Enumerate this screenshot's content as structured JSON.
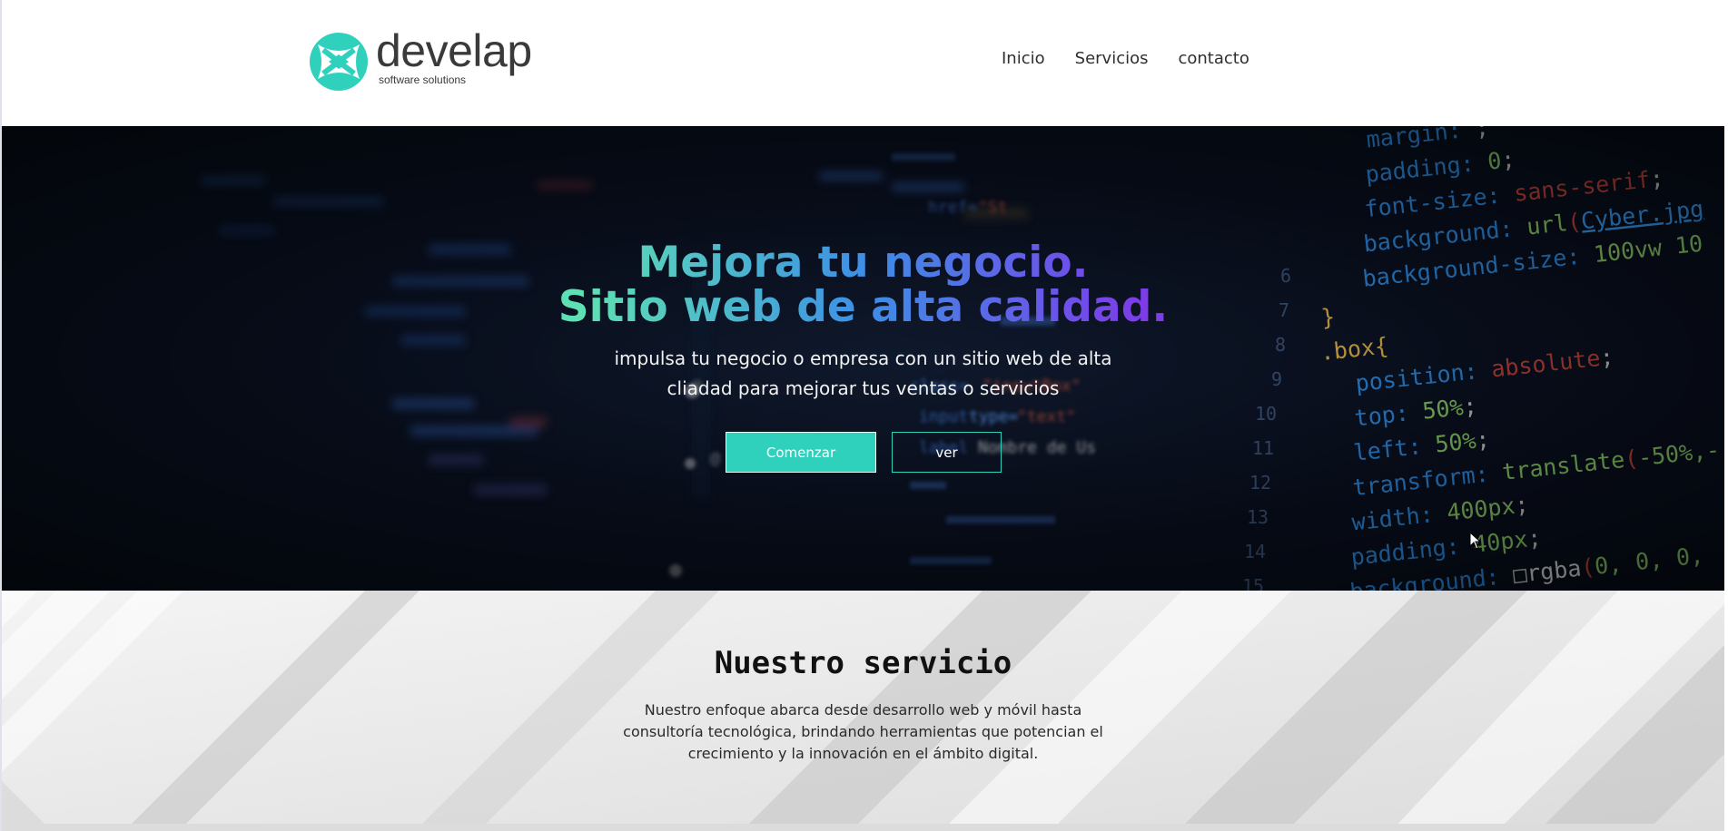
{
  "brand": {
    "name": "develap",
    "tagline": "software solutions",
    "accent": "#2fd1bd"
  },
  "nav": {
    "items": [
      "Inicio",
      "Servicios",
      "contacto"
    ]
  },
  "hero": {
    "title_line1": "Mejora tu negocio.",
    "title_line2": "Sitio web de alta calidad.",
    "subtitle_line1": "impulsa tu negocio o empresa con un sitio web de alta",
    "subtitle_line2": "cliadad para mejorar tus ventas o servicios",
    "primary_button": "Comenzar",
    "secondary_button": "ver",
    "code_background": {
      "line_numbers": [
        "6",
        "7",
        "8",
        "9",
        "10",
        "11",
        "12",
        "13",
        "14",
        "15"
      ],
      "lines": [
        "margin: ;",
        "padding: 0;",
        "font-size: sans-serif;",
        "background: url(Cyber.jpg",
        "background-size: 100vw 10",
        "}",
        ".box{",
        "position: absolute;",
        "top: 50%;",
        "left: 50%;",
        "transform: translate(-50%,-",
        "width: 400px;",
        "padding: 40px;",
        "background: rgba(0, 0, 0,"
      ],
      "blurred_snippets": [
        "href=\"St",
        "class=\"inputBox\"",
        "input type=\"text\"",
        "label Nombre de Us"
      ]
    }
  },
  "services": {
    "title": "Nuestro servicio",
    "description": "Nuestro enfoque abarca desde desarrollo web y móvil hasta consultoría tecnológica, brindando herramientas que potencian el crecimiento y la innovación en el ámbito digital."
  }
}
